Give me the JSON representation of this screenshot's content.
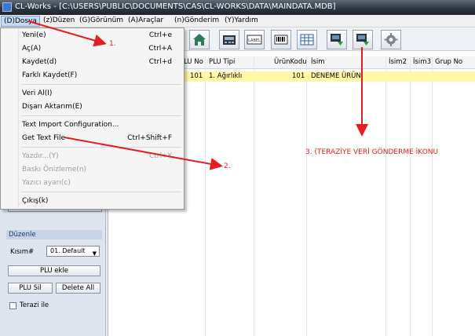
{
  "window": {
    "title": "CL-Works - [C:\\USERS\\PUBLIC\\DOCUMENTS\\CAS\\CL-WORKS\\DATA\\MAINDATA.MDB]"
  },
  "menubar": {
    "items": [
      "(D)Dosya",
      "(z)Düzen",
      "(G)Görünüm",
      "(A)Araçlar",
      "(n)Gönderim",
      "(Y)Yardım"
    ]
  },
  "toolbar": {
    "buttons": [
      "home-icon",
      "scale-icon",
      "label-icon",
      "barcode-icon",
      "grid-icon",
      "send-data-icon",
      "send-to-scale-icon",
      "settings-icon"
    ],
    "label_text": "LABEL"
  },
  "file_menu": {
    "items": [
      {
        "label": "Yeni(e)",
        "shortcut": "Ctrl+e",
        "enabled": true
      },
      {
        "label": "Aç(A)",
        "shortcut": "Ctrl+A",
        "enabled": true
      },
      {
        "label": "Kaydet(d)",
        "shortcut": "Ctrl+d",
        "enabled": true
      },
      {
        "label": "Farklı Kaydet(F)",
        "shortcut": "",
        "enabled": true
      },
      {
        "label": "Veri Al(I)",
        "shortcut": "",
        "enabled": true
      },
      {
        "label": "Dışarı Aktarım(E)",
        "shortcut": "",
        "enabled": true
      },
      {
        "label": "Text Import Configuration...",
        "shortcut": "",
        "enabled": true
      },
      {
        "label": "Get Text File",
        "shortcut": "Ctrl+Shift+F",
        "enabled": true
      },
      {
        "label": "Yazdır...(Y)",
        "shortcut": "Ctrl+Y",
        "enabled": false
      },
      {
        "label": "Baskı Önizleme(n)",
        "shortcut": "",
        "enabled": false
      },
      {
        "label": "Yazıcı ayarı(c)",
        "shortcut": "",
        "enabled": false
      },
      {
        "label": "Çıkış(k)",
        "shortcut": "",
        "enabled": true
      }
    ]
  },
  "grid": {
    "columns": [
      "LU No",
      "PLU Tipi",
      "ÜrünKodu",
      "İsim",
      "İsim2",
      "İsim3",
      "Grup No"
    ],
    "rows": [
      {
        "plu_no": "101",
        "plu_tipi": "1. Ağırlıklı",
        "urun_kodu": "101",
        "isim": "DENEME ÜRÜN"
      }
    ]
  },
  "left_panel": {
    "section_title": "Düzenle",
    "kisim_label": "Kısım#",
    "kisim_value": "01. Default",
    "plu_ekle": "PLU ekle",
    "plu_sil": "PLU Sil",
    "delete_all": "Delete All",
    "terazi_ile": "Terazi ile"
  },
  "annotations": {
    "a1": "1.",
    "a2": "2.",
    "a3": "3. (TERAZİYE VERİ GÖNDERME İKONU"
  },
  "colors": {
    "arrow": "#e41e1e",
    "row_highlight": "#fff9a6",
    "menu_highlight": "#c5dcf6"
  }
}
